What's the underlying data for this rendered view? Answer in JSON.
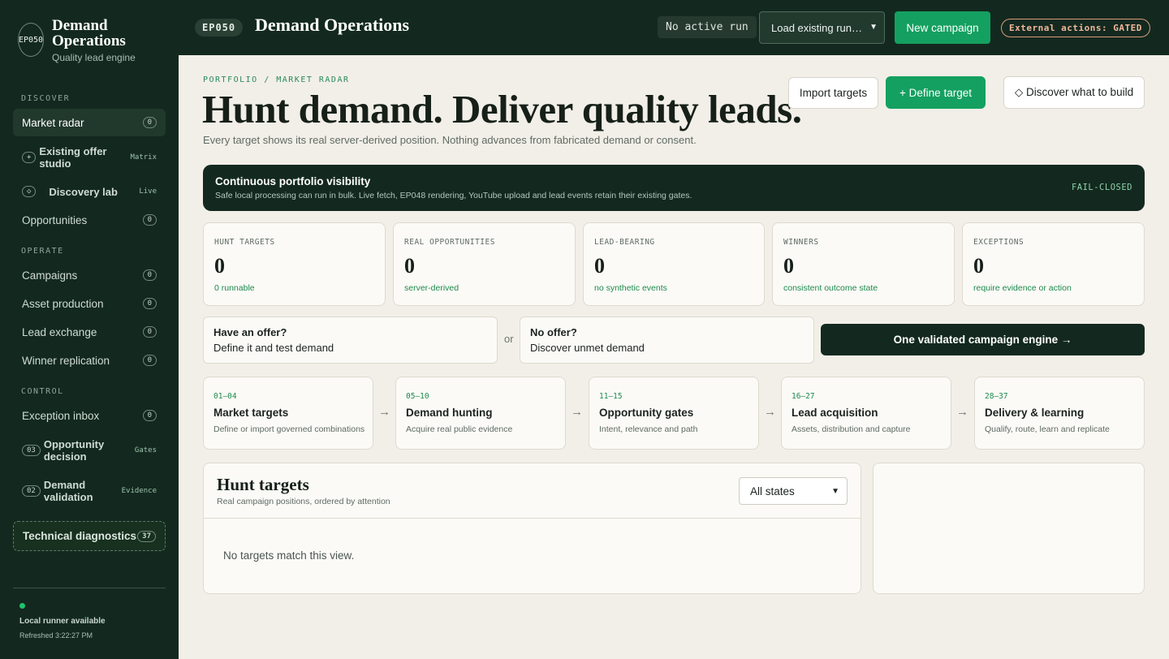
{
  "brand": {
    "logo": "EP050",
    "title": "Demand Operations",
    "subtitle": "Quality lead engine"
  },
  "sidebar": {
    "sections": [
      "DISCOVER",
      "OPERATE",
      "CONTROL"
    ],
    "items": [
      {
        "label": "Market radar",
        "count": "0"
      },
      {
        "prefix": "+",
        "label": "Existing offer studio",
        "tag": "Matrix"
      },
      {
        "prefix": "◇",
        "label": "Discovery lab",
        "tag": "Live"
      },
      {
        "label": "Opportunities",
        "count": "0"
      },
      {
        "label": "Campaigns",
        "count": "0"
      },
      {
        "label": "Asset production",
        "count": "0"
      },
      {
        "label": "Lead exchange",
        "count": "0"
      },
      {
        "label": "Winner replication",
        "count": "0"
      },
      {
        "label": "Exception inbox",
        "count": "0"
      },
      {
        "prefix": "03",
        "label": "Opportunity decision",
        "tag": "Gates"
      },
      {
        "prefix": "02",
        "label": "Demand validation",
        "tag": "Evidence"
      },
      {
        "label": "Technical diagnostics",
        "count": "37"
      }
    ],
    "runner": {
      "status": "Local runner available",
      "refreshed": "Refreshed 3:22:27 PM",
      "status_color": "#1ec46b"
    }
  },
  "topbar": {
    "code": "EP050",
    "title": "Demand Operations",
    "run_status": "No active run",
    "load_select": "Load existing run…",
    "new_campaign": "New campaign",
    "gated": "External actions: GATED"
  },
  "header": {
    "breadcrumb": "PORTFOLIO / MARKET RADAR",
    "title": "Hunt demand. Deliver quality leads.",
    "subtitle": "Every target shows its real server-derived position. Nothing advances from fabricated demand or consent.",
    "import": "Import targets",
    "define": "+ Define target",
    "discover": "◇ Discover what to build"
  },
  "banner": {
    "title": "Continuous portfolio visibility",
    "subtitle": "Safe local processing can run in bulk. Live fetch, EP048 rendering, YouTube upload and lead events retain their existing gates.",
    "tag": "FAIL-CLOSED"
  },
  "stats": [
    {
      "label": "HUNT TARGETS",
      "value": "0",
      "note": "0 runnable"
    },
    {
      "label": "REAL OPPORTUNITIES",
      "value": "0",
      "note": "server-derived"
    },
    {
      "label": "LEAD-BEARING",
      "value": "0",
      "note": "no synthetic events"
    },
    {
      "label": "WINNERS",
      "value": "0",
      "note": "consistent outcome state"
    },
    {
      "label": "EXCEPTIONS",
      "value": "0",
      "note": "require evidence or action"
    }
  ],
  "offer": {
    "have": {
      "question": "Have an offer?",
      "action": "Define it and test demand"
    },
    "or": "or",
    "none": {
      "question": "No offer?",
      "action": "Discover unmet demand"
    },
    "engine": "One validated campaign engine →"
  },
  "pipeline": {
    "arrow": "→",
    "stages": [
      {
        "range": "01–04",
        "title": "Market targets",
        "desc": "Define or import governed combinations"
      },
      {
        "range": "05–10",
        "title": "Demand hunting",
        "desc": "Acquire real public evidence"
      },
      {
        "range": "11–15",
        "title": "Opportunity gates",
        "desc": "Intent, relevance and path"
      },
      {
        "range": "16–27",
        "title": "Lead acquisition",
        "desc": "Assets, distribution and capture"
      },
      {
        "range": "28–37",
        "title": "Delivery & learning",
        "desc": "Qualify, route, learn and replicate"
      }
    ]
  },
  "targets": {
    "title": "Hunt targets",
    "subtitle": "Real campaign positions, ordered by attention",
    "filter": "All states",
    "empty": "No targets match this view."
  },
  "icons": {
    "select_chevron": "chevron-down-icon"
  }
}
